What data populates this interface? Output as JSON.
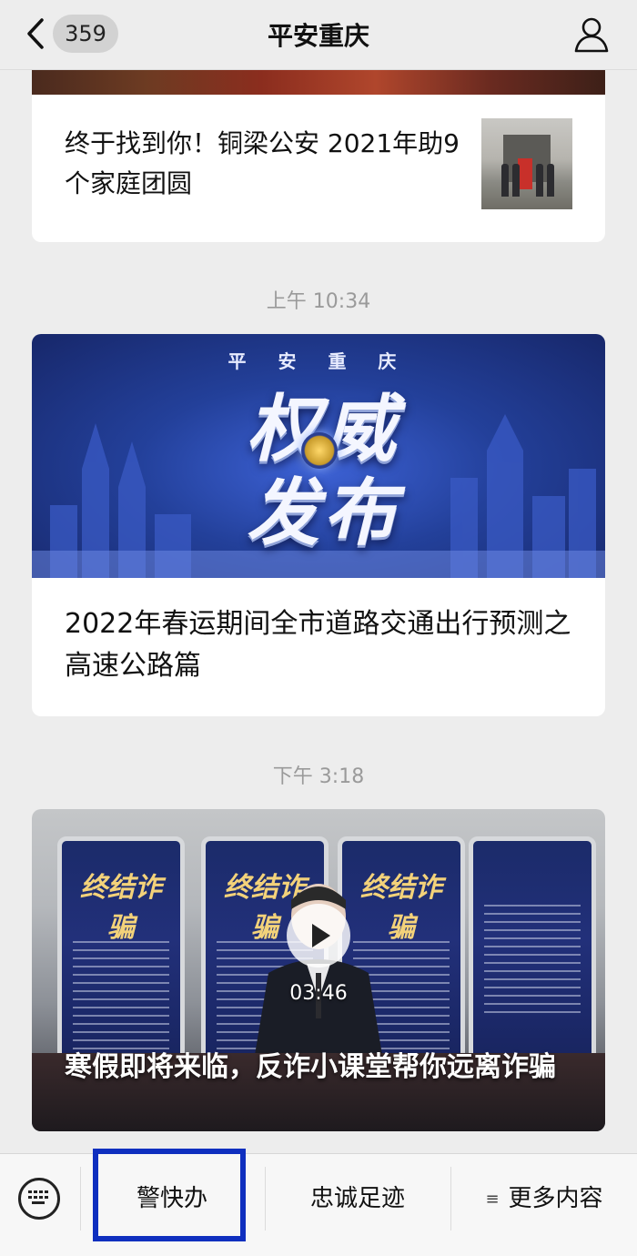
{
  "nav": {
    "badge": "359",
    "title": "平安重庆"
  },
  "articles": [
    {
      "title": "终于找到你！铜梁公安 2021年助9个家庭团圆"
    },
    {
      "time": "上午 10:34",
      "cover_kicker": "平 安 重 庆",
      "cover_line1": "权威",
      "cover_line2": "发布",
      "title": "2022年春运期间全市道路交通出行预测之高速公路篇"
    },
    {
      "time": "下午 3:18",
      "poster_text": "终结诈骗",
      "duration": "03:46",
      "title": "寒假即将来临，反诈小课堂帮你远离诈骗"
    }
  ],
  "menu": {
    "items": [
      "警快办",
      "忠诚足迹",
      "更多内容"
    ],
    "more_icon": "≡"
  },
  "colors": {
    "highlight": "#0f2fbf",
    "background": "#ededed"
  }
}
